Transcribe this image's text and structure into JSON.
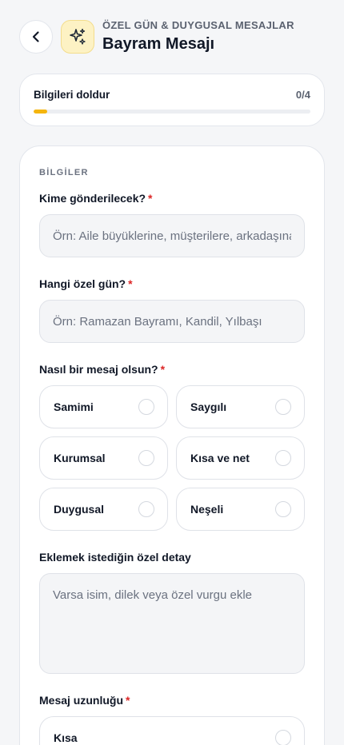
{
  "header": {
    "eyebrow": "ÖZEL GÜN & DUYGUSAL MESAJLAR",
    "title": "Bayram Mesajı",
    "back_icon": "chevron-left-icon",
    "category_icon": "sparkles-icon",
    "icon_color": "#d79a06"
  },
  "progress": {
    "label": "Bilgileri doldur",
    "count": "0/4",
    "value": 0.05,
    "fill_color": "#f5b50e"
  },
  "form": {
    "section_label": "BİLGİLER",
    "recipient": {
      "label": "Kime gönderilecek?",
      "required_mark": "*",
      "placeholder": "Örn: Aile büyüklerine, müşterilere, arkadaşına",
      "value": ""
    },
    "occasion": {
      "label": "Hangi özel gün?",
      "required_mark": "*",
      "placeholder": "Örn: Ramazan Bayramı, Kandil, Yılbaşı",
      "value": ""
    },
    "tone": {
      "label": "Nasıl bir mesaj olsun?",
      "required_mark": "*",
      "options": [
        "Samimi",
        "Saygılı",
        "Kurumsal",
        "Kısa ve net",
        "Duygusal",
        "Neşeli"
      ]
    },
    "detail": {
      "label": "Eklemek istediğin özel detay",
      "placeholder": "Varsa isim, dilek veya özel vurgu ekle",
      "value": ""
    },
    "length": {
      "label": "Mesaj uzunluğu",
      "required_mark": "*",
      "options": [
        "Kısa"
      ]
    }
  }
}
